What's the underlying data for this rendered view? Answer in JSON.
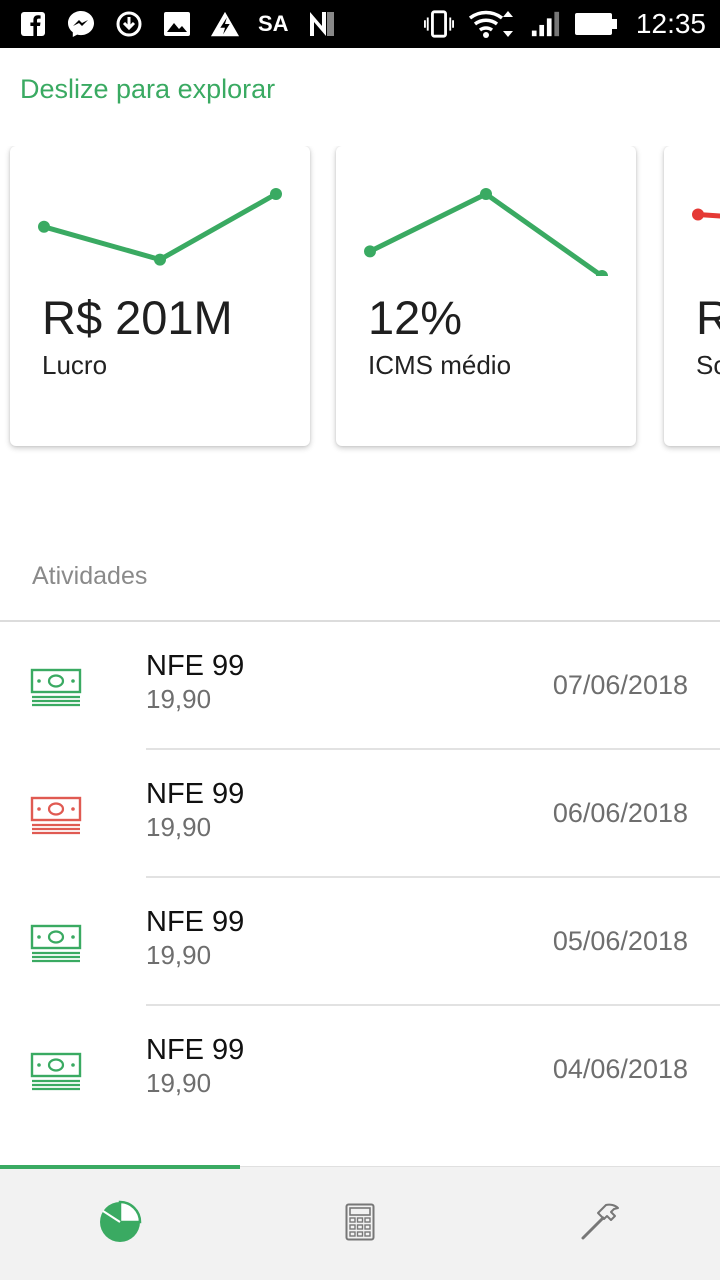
{
  "status_bar": {
    "time": "12:35",
    "carrier_text": "SA",
    "icons": [
      "facebook-icon",
      "messenger-icon",
      "download-icon",
      "image-icon",
      "flash-icon",
      "nfc-icon",
      "vibrate-icon",
      "wifi-icon",
      "signal-icon",
      "battery-icon"
    ]
  },
  "header": {
    "hint": "Deslize para explorar"
  },
  "cards": [
    {
      "value": "R$ 201M",
      "label": "Lucro",
      "trend_color": "#3aaa62",
      "trend": [
        0.6,
        0.2,
        1.0
      ]
    },
    {
      "value": "12%",
      "label": "ICMS médio",
      "trend_color": "#3aaa62",
      "trend": [
        0.3,
        1.0,
        0.0
      ]
    },
    {
      "value": "R",
      "label": "So",
      "trend_color": "#e53935",
      "trend": [
        0.75,
        0.65,
        0.5
      ]
    }
  ],
  "activities": {
    "title": "Atividades",
    "items": [
      {
        "title": "NFE 99",
        "amount": "19,90",
        "date": "07/06/2018",
        "icon": "money-icon",
        "color": "#3aaa62"
      },
      {
        "title": "NFE 99",
        "amount": "19,90",
        "date": "06/06/2018",
        "icon": "money-icon",
        "color": "#e05a52"
      },
      {
        "title": "NFE 99",
        "amount": "19,90",
        "date": "05/06/2018",
        "icon": "money-icon",
        "color": "#3aaa62"
      },
      {
        "title": "NFE 99",
        "amount": "19,90",
        "date": "04/06/2018",
        "icon": "money-icon",
        "color": "#3aaa62"
      }
    ]
  },
  "bottom_nav": {
    "items": [
      {
        "icon": "pie-chart-icon",
        "active": true
      },
      {
        "icon": "calculator-icon",
        "active": false
      },
      {
        "icon": "hammer-icon",
        "active": false
      }
    ],
    "accent": "#3aaa62"
  }
}
